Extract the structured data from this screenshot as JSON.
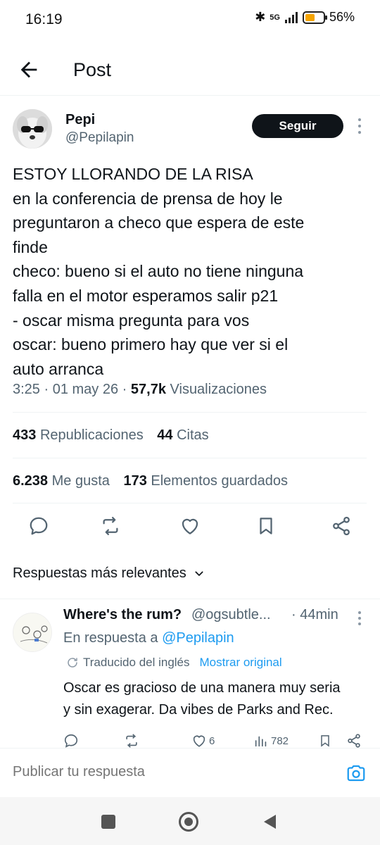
{
  "status_bar": {
    "time": "16:19",
    "network": "5G",
    "battery": "56%",
    "battery_level": 0.56
  },
  "header": {
    "title": "Post"
  },
  "post": {
    "author_name": "Pepi",
    "author_handle": "@Pepilapin",
    "follow_label": "Seguir",
    "text_lines": [
      "ESTOY LLORANDO DE LA RISA",
      "en la conferencia de prensa de hoy le",
      "preguntaron a checo que espera de este",
      "finde",
      "checo: bueno si el auto no tiene ninguna",
      "falla en el motor esperamos salir p21",
      "- oscar misma pregunta para vos",
      "oscar: bueno primero hay que ver si el",
      "auto arranca"
    ],
    "time": "3:25",
    "date": "01 may 26",
    "views": "57,7k",
    "views_label": "Visualizaciones",
    "reposts": "433",
    "reposts_label": "Republicaciones",
    "quotes": "44",
    "quotes_label": "Citas",
    "likes": "6.238",
    "likes_label": "Me gusta",
    "bookmarks": "173",
    "bookmarks_label": "Elementos guardados"
  },
  "replies_sort_label": "Respuestas más relevantes",
  "reply": {
    "author_name": "Where's the rum?",
    "author_handle": "@ogsubtle...",
    "time": "· 44min",
    "replying_to_prefix": "En respuesta a",
    "replying_to_handle": "@Pepilapin",
    "translated_label": "Traducido del inglés",
    "show_original_label": "Mostrar original",
    "text_lines": [
      "Oscar es gracioso de una manera muy seria",
      "y sin exagerar. Da vibes de Parks and Rec."
    ],
    "likes": "6",
    "views": "782"
  },
  "composer": {
    "placeholder": "Publicar tu respuesta"
  },
  "colors": {
    "accent": "#1d9bf0",
    "text": "#0f1419",
    "secondary": "#536471"
  }
}
